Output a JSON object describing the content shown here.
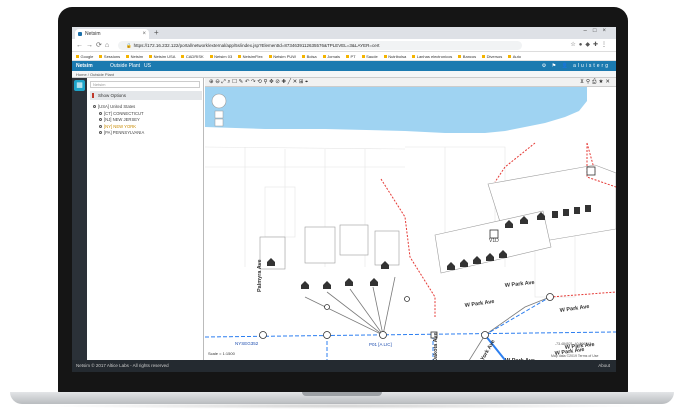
{
  "browser": {
    "tab_title": "Netsim",
    "url": "https://172.16.232.122/portal/network/external/app/5s/index.jsp?ElementId=8734639112635576&TPLEVEL=3&LAYER=cert",
    "bookmarks": [
      "Google",
      "Sessions",
      "Netsim",
      "Netsim USA",
      "CADRISK",
      "Netsim 03",
      "NetsimFlex",
      "Netsim PUW",
      "Bolsa",
      "Jornais",
      "PT",
      "Saude",
      "Nutribolsa",
      "Lanhas electronicos",
      "Bancos",
      "Diversos",
      "Auto"
    ]
  },
  "app": {
    "logo": "Netsim",
    "menu_1": "Outside Plant",
    "menu_2": "US",
    "user": "aluisterg",
    "breadcrumb": "Home / Outside Plant"
  },
  "panel": {
    "search_placeholder": "Netsim",
    "options_label": "Show Options",
    "tree": [
      {
        "label": "[USA] United States",
        "level": 0,
        "highlight": false
      },
      {
        "label": "[CT] CONNECTICUT",
        "level": 1,
        "highlight": false
      },
      {
        "label": "[NJ] NEW JERSEY",
        "level": 1,
        "highlight": false
      },
      {
        "label": "[NY] NEW YORK",
        "level": 1,
        "highlight": true
      },
      {
        "label": "[PA] PENNSYLVANIA",
        "level": 1,
        "highlight": false
      }
    ]
  },
  "map": {
    "street_labels": [
      "Park Ave",
      "W Park Ave",
      "W Park Ave",
      "W Park Ave",
      "W Park Ave",
      "W Park Ave",
      "W Park Ave",
      "W Park Ave",
      "W Park Ave",
      "W Park Ave",
      "Palmyra Ave",
      "Dakota Ave",
      "New York Ave"
    ],
    "node_labels": [
      "NYSEG352",
      "P01 [A LIC]",
      "V1D"
    ],
    "scale_label": "Scale = 1:1500",
    "coords_label": "-73.484521, 40.896317",
    "attribution": "Map data ©2019  Terms of Use",
    "colors": {
      "water": "#9fd3f2",
      "cable_blue": "#2d7ff0",
      "cable_red": "#e53935",
      "cable_gray": "#7a7a7a"
    }
  },
  "footer": {
    "copyright": "Netsim © 2017 Altice Labs - All rights reserved",
    "about": "About"
  }
}
